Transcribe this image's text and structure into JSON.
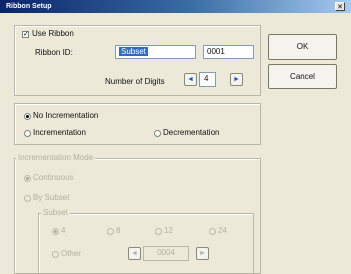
{
  "window": {
    "title": "Ribbon Setup",
    "close_glyph": "✕"
  },
  "use_ribbon": {
    "label": "Use Ribbon",
    "checked": true,
    "check_glyph": "✓"
  },
  "ribbon_id": {
    "label": "Ribbon ID:",
    "value": "Subset",
    "number": "0001"
  },
  "digits": {
    "label": "Number of Digits",
    "value": "4",
    "dec_glyph": "◄",
    "inc_glyph": "►"
  },
  "buttons": {
    "ok": "OK",
    "cancel": "Cancel"
  },
  "increment": {
    "no_increment": "No Incrementation",
    "increment": "Incrementation",
    "decrement": "Decrementation",
    "selected": "no_increment"
  },
  "mode": {
    "legend": "Incrementation Mode",
    "continuous": "Continuous",
    "by_subset": "By Subset",
    "subset": {
      "legend": "Subset",
      "options": [
        "4",
        "8",
        "12",
        "24"
      ],
      "other": "Other",
      "other_value": "0004",
      "dec_glyph": "◄",
      "inc_glyph": "►"
    }
  }
}
